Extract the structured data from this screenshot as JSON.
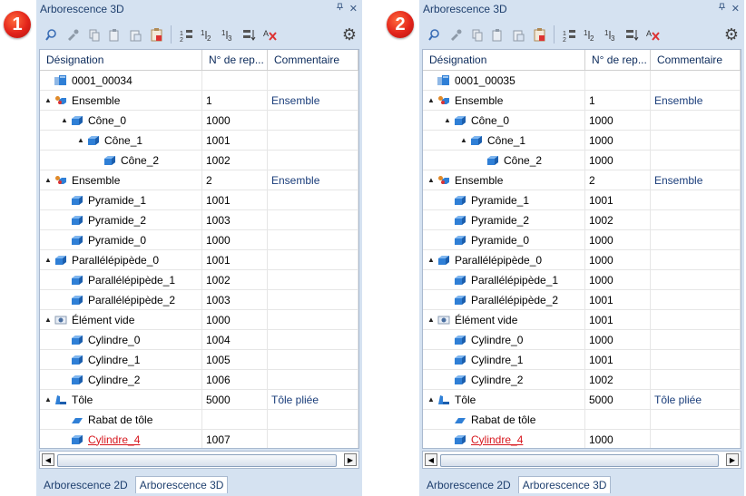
{
  "panels": [
    {
      "badge": "1",
      "title": "Arborescence 3D",
      "pin_icon": "pin-icon",
      "close_label": "✕",
      "columns": [
        "Désignation",
        "N° de rep...",
        "Commentaire"
      ],
      "tabs": [
        "Arborescence 2D",
        "Arborescence 3D"
      ],
      "rows": [
        {
          "level": 0,
          "expander": "",
          "icon": "assembly-root",
          "name": "0001_00034",
          "num": "",
          "comment": ""
        },
        {
          "level": 0,
          "expander": "▲",
          "icon": "assembly",
          "name": "Ensemble",
          "num": "1",
          "comment": "Ensemble"
        },
        {
          "level": 1,
          "expander": "▲",
          "icon": "solid",
          "name": "Cône_0",
          "num": "1000",
          "comment": ""
        },
        {
          "level": 2,
          "expander": "▲",
          "icon": "solid",
          "name": "Cône_1",
          "num": "1001",
          "comment": ""
        },
        {
          "level": 3,
          "expander": "",
          "icon": "solid",
          "name": "Cône_2",
          "num": "1002",
          "comment": ""
        },
        {
          "level": 0,
          "expander": "▲",
          "icon": "assembly",
          "name": "Ensemble",
          "num": "2",
          "comment": "Ensemble"
        },
        {
          "level": 1,
          "expander": "",
          "icon": "solid",
          "name": "Pyramide_1",
          "num": "1001",
          "comment": ""
        },
        {
          "level": 1,
          "expander": "",
          "icon": "solid",
          "name": "Pyramide_2",
          "num": "1003",
          "comment": ""
        },
        {
          "level": 1,
          "expander": "",
          "icon": "solid",
          "name": "Pyramide_0",
          "num": "1000",
          "comment": ""
        },
        {
          "level": 0,
          "expander": "▲",
          "icon": "solid",
          "name": "Parallélépipède_0",
          "num": "1001",
          "comment": ""
        },
        {
          "level": 1,
          "expander": "",
          "icon": "solid",
          "name": "Parallélépipède_1",
          "num": "1002",
          "comment": ""
        },
        {
          "level": 1,
          "expander": "",
          "icon": "solid",
          "name": "Parallélépipède_2",
          "num": "1003",
          "comment": ""
        },
        {
          "level": 0,
          "expander": "▲",
          "icon": "empty-element",
          "name": "Élément vide",
          "num": "1000",
          "comment": ""
        },
        {
          "level": 1,
          "expander": "",
          "icon": "solid",
          "name": "Cylindre_0",
          "num": "1004",
          "comment": ""
        },
        {
          "level": 1,
          "expander": "",
          "icon": "solid",
          "name": "Cylindre_1",
          "num": "1005",
          "comment": ""
        },
        {
          "level": 1,
          "expander": "",
          "icon": "solid",
          "name": "Cylindre_2",
          "num": "1006",
          "comment": ""
        },
        {
          "level": 0,
          "expander": "▲",
          "icon": "sheet-metal",
          "name": "Tôle",
          "num": "5000",
          "comment": "Tôle pliée"
        },
        {
          "level": 1,
          "expander": "",
          "icon": "flange",
          "name": "Rabat de tôle",
          "num": "",
          "comment": ""
        },
        {
          "level": 1,
          "expander": "",
          "icon": "solid",
          "name": "Cylindre_4",
          "num": "1007",
          "comment": "",
          "highlight": true
        }
      ]
    },
    {
      "badge": "2",
      "title": "Arborescence 3D",
      "pin_icon": "pin-icon",
      "close_label": "✕",
      "columns": [
        "Désignation",
        "N° de rep...",
        "Commentaire"
      ],
      "tabs": [
        "Arborescence 2D",
        "Arborescence 3D"
      ],
      "rows": [
        {
          "level": 0,
          "expander": "",
          "icon": "assembly-root",
          "name": "0001_00035",
          "num": "",
          "comment": ""
        },
        {
          "level": 0,
          "expander": "▲",
          "icon": "assembly",
          "name": "Ensemble",
          "num": "1",
          "comment": "Ensemble"
        },
        {
          "level": 1,
          "expander": "▲",
          "icon": "solid",
          "name": "Cône_0",
          "num": "1000",
          "comment": ""
        },
        {
          "level": 2,
          "expander": "▲",
          "icon": "solid",
          "name": "Cône_1",
          "num": "1000",
          "comment": ""
        },
        {
          "level": 3,
          "expander": "",
          "icon": "solid",
          "name": "Cône_2",
          "num": "1000",
          "comment": ""
        },
        {
          "level": 0,
          "expander": "▲",
          "icon": "assembly",
          "name": "Ensemble",
          "num": "2",
          "comment": "Ensemble"
        },
        {
          "level": 1,
          "expander": "",
          "icon": "solid",
          "name": "Pyramide_1",
          "num": "1001",
          "comment": ""
        },
        {
          "level": 1,
          "expander": "",
          "icon": "solid",
          "name": "Pyramide_2",
          "num": "1002",
          "comment": ""
        },
        {
          "level": 1,
          "expander": "",
          "icon": "solid",
          "name": "Pyramide_0",
          "num": "1000",
          "comment": ""
        },
        {
          "level": 0,
          "expander": "▲",
          "icon": "solid",
          "name": "Parallélépipède_0",
          "num": "1000",
          "comment": ""
        },
        {
          "level": 1,
          "expander": "",
          "icon": "solid",
          "name": "Parallélépipède_1",
          "num": "1000",
          "comment": ""
        },
        {
          "level": 1,
          "expander": "",
          "icon": "solid",
          "name": "Parallélépipède_2",
          "num": "1001",
          "comment": ""
        },
        {
          "level": 0,
          "expander": "▲",
          "icon": "empty-element",
          "name": "Élément vide",
          "num": "1001",
          "comment": ""
        },
        {
          "level": 1,
          "expander": "",
          "icon": "solid",
          "name": "Cylindre_0",
          "num": "1000",
          "comment": ""
        },
        {
          "level": 1,
          "expander": "",
          "icon": "solid",
          "name": "Cylindre_1",
          "num": "1001",
          "comment": ""
        },
        {
          "level": 1,
          "expander": "",
          "icon": "solid",
          "name": "Cylindre_2",
          "num": "1002",
          "comment": ""
        },
        {
          "level": 0,
          "expander": "▲",
          "icon": "sheet-metal",
          "name": "Tôle",
          "num": "5000",
          "comment": "Tôle pliée"
        },
        {
          "level": 1,
          "expander": "",
          "icon": "flange",
          "name": "Rabat de tôle",
          "num": "",
          "comment": ""
        },
        {
          "level": 1,
          "expander": "",
          "icon": "solid",
          "name": "Cylindre_4",
          "num": "1000",
          "comment": "",
          "highlight": true
        }
      ]
    }
  ],
  "toolbar_icons": [
    "find-icon",
    "pipette-icon",
    "copy-icon",
    "paste-icon",
    "paste-special-icon",
    "clipboard-icon",
    "numbering-icon",
    "renumber-1-icon",
    "renumber-2-icon",
    "renumber-3-icon",
    "clear-numbering-icon"
  ],
  "colors": {
    "panel_bg": "#d5e2f1",
    "accent_text": "#1e3f6e",
    "highlight_red": "#d7181f",
    "solid_blue": "#2f7fd6"
  }
}
